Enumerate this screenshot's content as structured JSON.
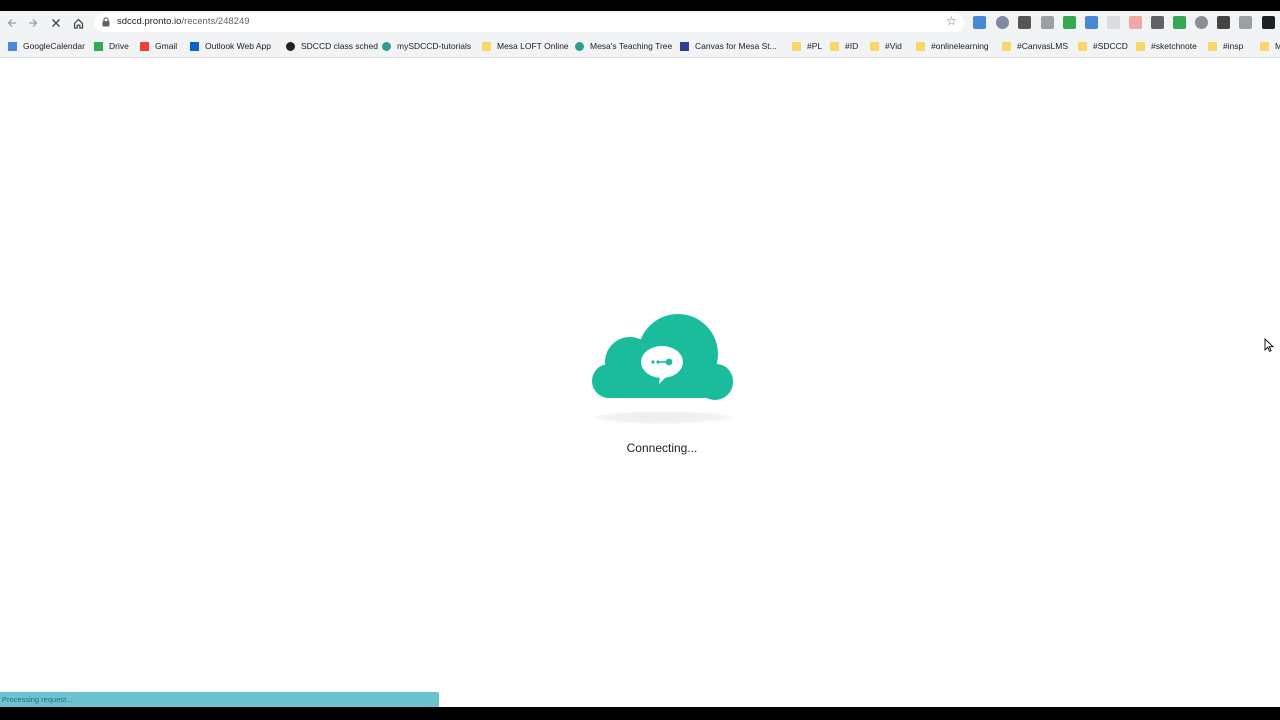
{
  "browser": {
    "url_host": "sdccd.pronto.io",
    "url_path": "/recents/248249",
    "nav": {
      "back_icon": "back-arrow-icon",
      "forward_icon": "forward-arrow-icon",
      "home_icon": "home-icon",
      "stop_icon": "stop-loading-icon"
    },
    "bookmark_icon": "star-icon",
    "extensions": [
      {
        "name": "calendar-new-ext-icon",
        "color": "#4a87d6"
      },
      {
        "name": "shield-ext-icon",
        "color": "#7f8aa0"
      },
      {
        "name": "qr-ext-icon",
        "color": "#555555"
      },
      {
        "name": "bookmark-ext-icon",
        "color": "#9aa0a6"
      },
      {
        "name": "green-box-ext-icon",
        "color": "#34a853"
      },
      {
        "name": "grid-ext-icon",
        "color": "#4a87d6"
      },
      {
        "name": "doc-ext-icon",
        "color": "#dadce0"
      },
      {
        "name": "record-ext-icon",
        "color": "#f2a7a7"
      },
      {
        "name": "camera-ext-icon",
        "color": "#5f6368"
      },
      {
        "name": "check-ext-icon",
        "color": "#34a853"
      },
      {
        "name": "globe-ext-icon",
        "color": "#8a8f96"
      },
      {
        "name": "notion-ext-icon",
        "color": "#444444"
      },
      {
        "name": "screenshot-ext-icon",
        "color": "#9aa0a6"
      },
      {
        "name": "puzzle-ext-icon",
        "color": "#202124"
      }
    ]
  },
  "bookmarks": [
    {
      "label": "GoogleCalendar",
      "icon": "calendar-icon",
      "color": "#4a87d6"
    },
    {
      "label": "Drive",
      "icon": "drive-icon",
      "color": "#34a853"
    },
    {
      "label": "Gmail",
      "icon": "gmail-icon",
      "color": "#ea4335"
    },
    {
      "label": "Outlook Web App",
      "icon": "outlook-icon",
      "color": "#0a64c8"
    },
    {
      "label": "SDCCD class sched",
      "icon": "globe-icon",
      "color": "#222222"
    },
    {
      "label": "mySDCCD-tutorials",
      "icon": "tree-icon",
      "color": "#2a9d8f"
    },
    {
      "label": "Mesa LOFT Online",
      "icon": "folder-icon",
      "color": "#f8d66b"
    },
    {
      "label": "Mesa's Teaching Tree",
      "icon": "tree-icon",
      "color": "#2a9d8f"
    },
    {
      "label": "Canvas for Mesa St...",
      "icon": "canvas-icon",
      "color": "#2c3e91"
    },
    {
      "label": "#PL",
      "icon": "folder-icon",
      "color": "#f8d66b"
    },
    {
      "label": "#ID",
      "icon": "folder-icon",
      "color": "#f8d66b"
    },
    {
      "label": "#Vid",
      "icon": "folder-icon",
      "color": "#f8d66b"
    },
    {
      "label": "#onlinelearning",
      "icon": "folder-icon",
      "color": "#f8d66b"
    },
    {
      "label": "#CanvasLMS",
      "icon": "folder-icon",
      "color": "#f8d66b"
    },
    {
      "label": "#SDCCD",
      "icon": "folder-icon",
      "color": "#f8d66b"
    },
    {
      "label": "#sketchnote",
      "icon": "folder-icon",
      "color": "#f8d66b"
    },
    {
      "label": "#insp",
      "icon": "folder-icon",
      "color": "#f8d66b"
    },
    {
      "label": "Mo",
      "icon": "folder-icon",
      "color": "#f8d66b"
    }
  ],
  "main": {
    "logo_icon": "pronto-cloud-chat-icon",
    "accent": "#1abc9c",
    "status_text": "Connecting..."
  },
  "statusbar": {
    "text": "Processing request..."
  }
}
